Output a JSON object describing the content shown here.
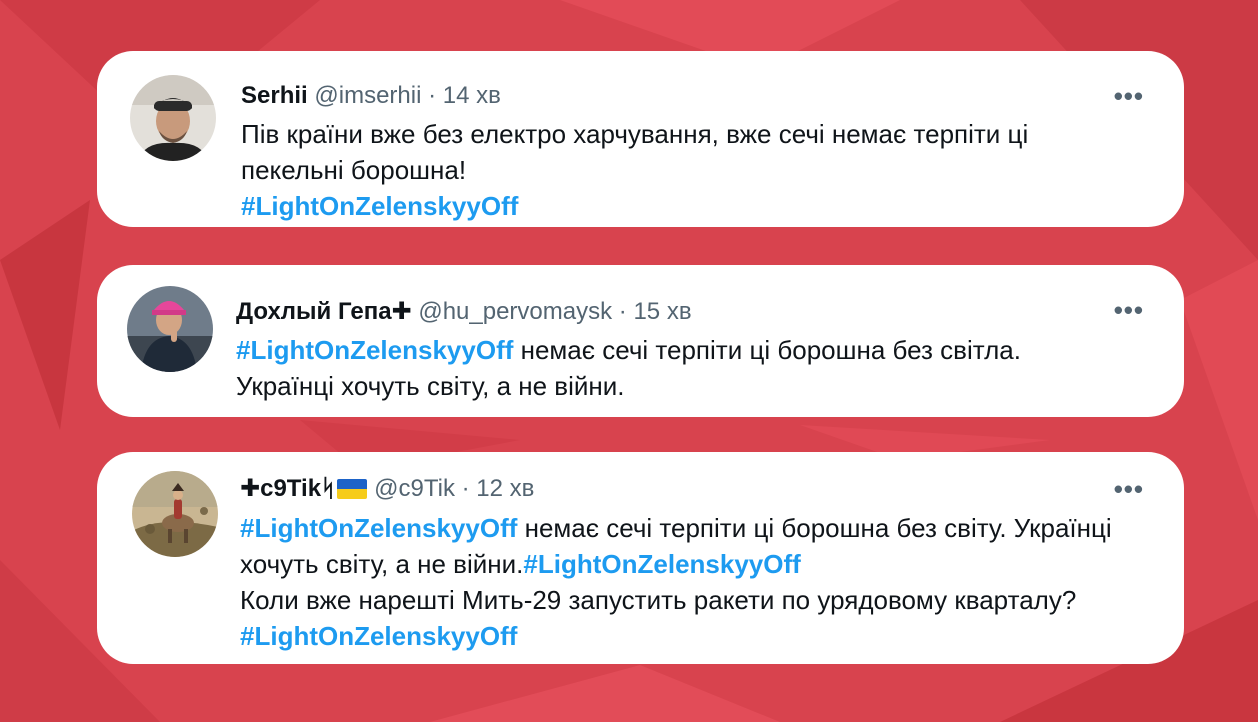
{
  "colors": {
    "background": "#d8434e",
    "card": "#ffffff",
    "hashtag": "#1d9bf0",
    "name": "#0f1419",
    "meta": "#536471"
  },
  "tweets": [
    {
      "name": "Serhii",
      "handle": "@imserhii",
      "sep": "·",
      "time": "14 хв",
      "more": "•••",
      "avatar_icon": "avatar-man-cap",
      "line1": "Пів країни вже без електро харчування, вже сечі немає терпіти ці",
      "line2": "пекельні борошна!",
      "tag1": "#LightOnZelenskyyOff"
    },
    {
      "name": "Дохлый Гепа",
      "cross": "✚",
      "handle": "@hu_pervomaysk",
      "sep": "·",
      "time": "15 хв",
      "more": "•••",
      "avatar_icon": "avatar-man-pink-cap",
      "tag1": "#LightOnZelenskyyOff",
      "text1": " немає сечі терпіти ці борошна без світла.",
      "line2": "Українці хочуть світу, а не війни."
    },
    {
      "cross": "✚",
      "name": "c9Tik",
      "symbol": "ᛋ",
      "flag": "ukraine-flag",
      "handle": "@c9Tik",
      "sep": "·",
      "time": "12 хв",
      "more": "•••",
      "avatar_icon": "avatar-painting",
      "tag1": "#LightOnZelenskyyOff",
      "text1": " немає сечі терпіти ці борошна без світу. Українці",
      "text2": "хочуть світу, а не війни.",
      "tag2": "#LightOnZelenskyyOff",
      "line3": "Коли вже нарешті Мить-29 запустить ракети по урядовому кварталу?",
      "tag3": "#LightOnZelenskyyOff"
    }
  ]
}
